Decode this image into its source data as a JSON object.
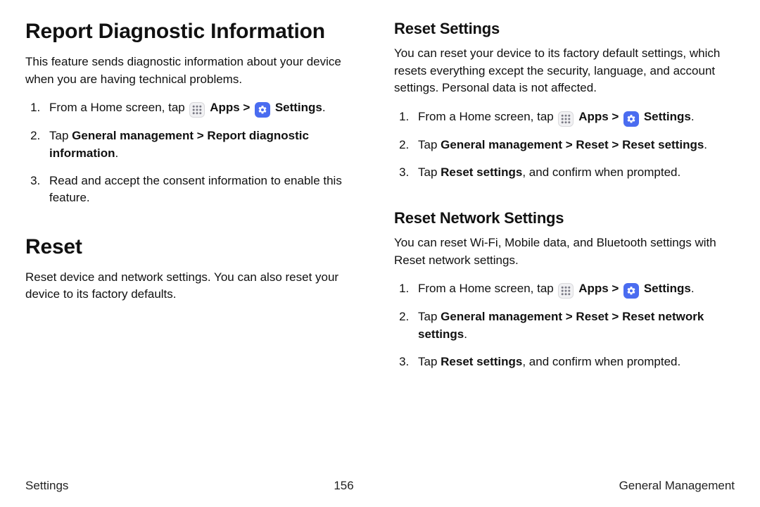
{
  "left": {
    "h_report": "Report Diagnostic Information",
    "p_report": "This feature sends diagnostic information about your device when you are having technical problems.",
    "step1_a": "From a Home screen, tap ",
    "apps_label": "Apps",
    "chevron": " > ",
    "settings_label": "Settings",
    "step2_a": "Tap ",
    "step2_b": "General management > Report diagnostic information",
    "step3": "Read and accept the consent information to enable this feature.",
    "h_reset": "Reset",
    "p_reset": "Reset device and network settings. You can also reset your device to its factory defaults."
  },
  "right": {
    "h_rs": "Reset Settings",
    "p_rs": "You can reset your device to its factory default settings, which resets everything except the security, language, and account settings. Personal data is not affected.",
    "rs_step1_a": "From a Home screen, tap ",
    "apps_label": "Apps",
    "chevron": " > ",
    "settings_label": "Settings",
    "rs_step2_a": "Tap ",
    "rs_step2_b": "General management > Reset > Reset settings",
    "rs_step3_a": "Tap ",
    "rs_step3_b": "Reset settings",
    "rs_step3_c": ", and confirm when prompted.",
    "h_rns": "Reset Network Settings",
    "p_rns": "You can reset Wi-Fi, Mobile data, and Bluetooth settings with Reset network settings.",
    "rns_step1_a": "From a Home screen, tap ",
    "rns_step2_a": "Tap ",
    "rns_step2_b": "General management > Reset > Reset network settings",
    "rns_step3_a": "Tap ",
    "rns_step3_b": "Reset settings",
    "rns_step3_c": ", and confirm when prompted."
  },
  "footer": {
    "left": "Settings",
    "center": "156",
    "right": "General Management"
  },
  "period": "."
}
